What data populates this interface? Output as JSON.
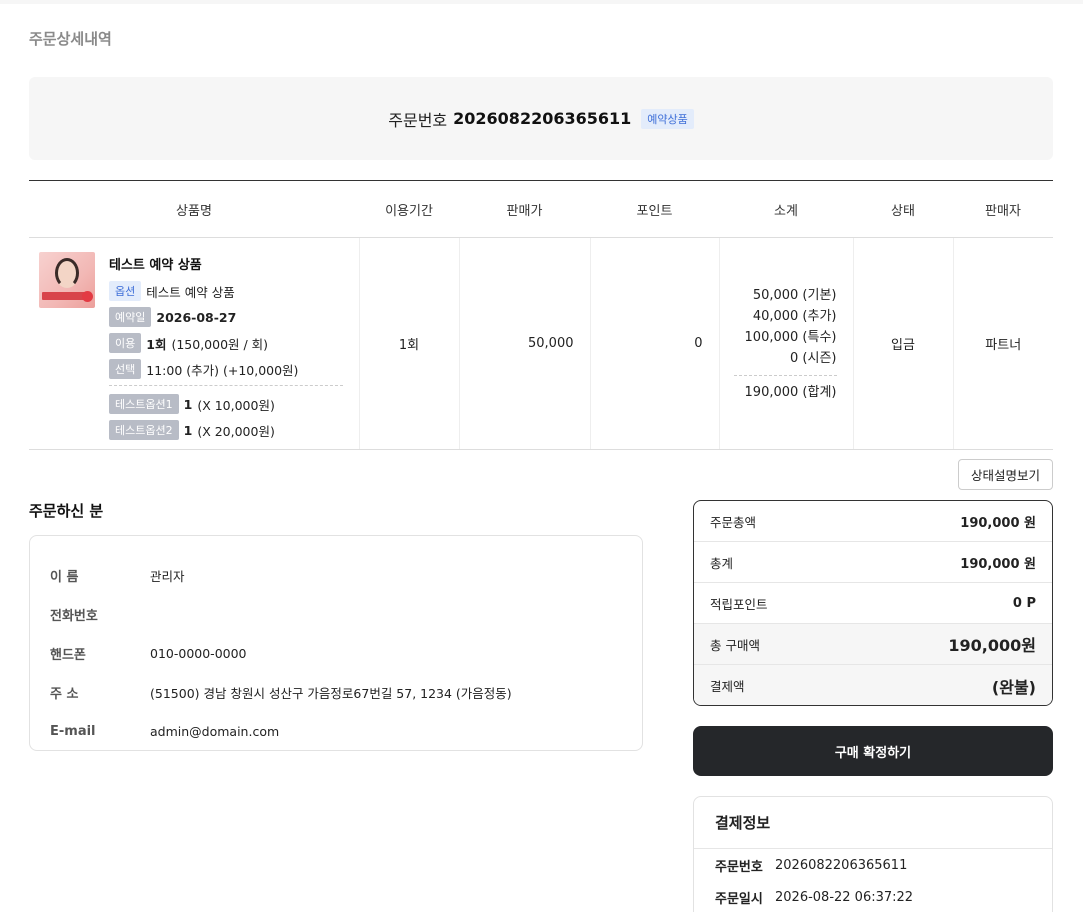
{
  "page": {
    "title": "주문상세내역"
  },
  "order": {
    "label": "주문번호",
    "number": "2026082206365611",
    "badge": "예약상품"
  },
  "table": {
    "headers": [
      "상품명",
      "이용기간",
      "판매가",
      "포인트",
      "소계",
      "상태",
      "판매자"
    ],
    "item": {
      "name": "테스트 예약 상품",
      "option_tag": "옵션",
      "option_value": "테스트 예약 상품",
      "reserve_tag": "예약일",
      "reserve_date": "2026-08-27",
      "use_tag": "이용",
      "use_count": "1회",
      "use_detail": "(150,000원 / 회)",
      "select_tag": "선택",
      "select_value": "11:00 (추가) (+10,000원)",
      "extra1_tag": "테스트옵션1",
      "extra1_qty": "1",
      "extra1_detail": "(X 10,000원)",
      "extra2_tag": "테스트옵션2",
      "extra2_qty": "1",
      "extra2_detail": "(X 20,000원)",
      "period": "1회",
      "price": "50,000",
      "point": "0",
      "subtotal_lines": [
        "50,000 (기본)",
        "40,000 (추가)",
        "100,000 (특수)",
        "0 (시즌)"
      ],
      "subtotal_total": "190,000 (합계)",
      "status": "입금",
      "seller": "파트너"
    }
  },
  "status_button": "상태설명보기",
  "orderer": {
    "title": "주문하신 분",
    "rows": [
      {
        "label": "이 름",
        "value": "관리자"
      },
      {
        "label": "전화번호",
        "value": ""
      },
      {
        "label": "핸드폰",
        "value": "010-0000-0000"
      },
      {
        "label": "주 소",
        "value": "(51500) 경남 창원시 성산구 가음정로67번길 57, 1234 (가음정동)"
      },
      {
        "label": "E-mail",
        "value": "admin@domain.com"
      }
    ]
  },
  "summary": {
    "rows": [
      {
        "label": "주문총액",
        "value": "190,000 원"
      },
      {
        "label": "총계",
        "value": "190,000 원"
      },
      {
        "label": "적립포인트",
        "value": "0 P"
      },
      {
        "label": "총 구매액",
        "value": "190,000원"
      },
      {
        "label": "결제액",
        "value": "(완불)"
      }
    ]
  },
  "confirm_button": "구매 확정하기",
  "payment": {
    "title": "결제정보",
    "rows": [
      {
        "label": "주문번호",
        "value": "2026082206365611"
      },
      {
        "label": "주문일시",
        "value": "2026-08-22 06:37:22"
      }
    ]
  }
}
